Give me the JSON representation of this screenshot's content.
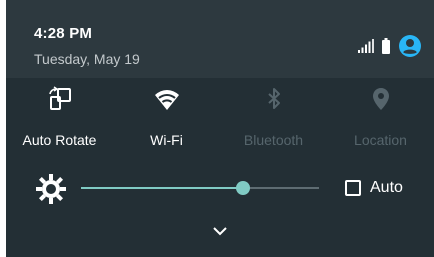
{
  "header": {
    "time": "4:28 PM",
    "date": "Tuesday, May 19",
    "icons": [
      "signal-icon",
      "battery-icon",
      "account-icon"
    ]
  },
  "tiles": [
    {
      "label": "Auto Rotate",
      "icon": "auto-rotate-icon",
      "active": true
    },
    {
      "label": "Wi-Fi",
      "icon": "wifi-icon",
      "active": true
    },
    {
      "label": "Bluetooth",
      "icon": "bluetooth-icon",
      "active": false
    },
    {
      "label": "Location",
      "icon": "location-icon",
      "active": false
    }
  ],
  "brightness": {
    "level": 0.68,
    "auto_label": "Auto",
    "auto_checked": false,
    "icon": "brightness-icon"
  },
  "colors": {
    "panel_bg": "#232f35",
    "header_bg": "#2d393f",
    "accent": "#80cbc4",
    "account_blue": "#29b6f6",
    "inactive": "#56656c"
  }
}
